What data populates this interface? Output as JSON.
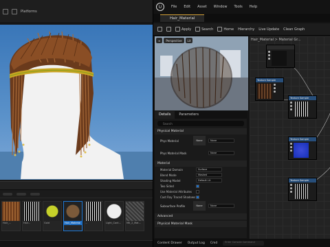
{
  "left_window": {
    "platforms_label": "Platforms",
    "assets": [
      {
        "label": "Hair_..."
      },
      {
        "label": "Hair..."
      },
      {
        "label": "Gold"
      },
      {
        "label": "Hair_Material"
      },
      {
        "label": "..."
      },
      {
        "label": "Light_Cont..."
      },
      {
        "label": "Mtl_2_Mat..."
      },
      {
        "label": "Hair..."
      }
    ]
  },
  "menu": {
    "logo": "U",
    "items": [
      "File",
      "Edit",
      "Asset",
      "Window",
      "Tools",
      "Help"
    ]
  },
  "tab": {
    "title": "Hair_Material"
  },
  "toolbar": {
    "items": [
      "Save",
      "Browse",
      "Apply",
      "Search",
      "Home",
      "Hierarchy",
      "Live Update",
      "Clean Graph"
    ]
  },
  "preview": {
    "perspective": "Perspective",
    "lit": "Lit"
  },
  "details": {
    "tabs": [
      "Details",
      "Parameters"
    ],
    "search_placeholder": "Search",
    "section_physical": "Physical Material",
    "phys_material_label": "Phys Material",
    "phys_material_value": "None",
    "phys_mask_label": "Phys Material Mask",
    "phys_mask_value": "None",
    "section_material": "Material",
    "rows": [
      {
        "key": "Material Domain",
        "value": "Surface"
      },
      {
        "key": "Blend Mode",
        "value": "Masked"
      },
      {
        "key": "Shading Model",
        "value": "Default Lit"
      }
    ],
    "checks": [
      {
        "key": "Two Sided",
        "on": true
      },
      {
        "key": "Use Material Attributes",
        "on": false
      },
      {
        "key": "Cast Ray Traced Shadows",
        "on": true
      }
    ],
    "subsurface_label": "Subsurface Profile",
    "subsurface_value": "None",
    "section_advanced": "Advanced",
    "section_mask": "Physical Material Mask",
    "slot_none": "None"
  },
  "statusbar": {
    "content_drawer": "Content Drawer",
    "output_log": "Output Log",
    "cmd": "Cmd",
    "cmd_placeholder": "Enter Console Command"
  },
  "graph": {
    "breadcrumb": "Hair_Material  >  Material Gr...",
    "node_title": "Texture Sample"
  }
}
